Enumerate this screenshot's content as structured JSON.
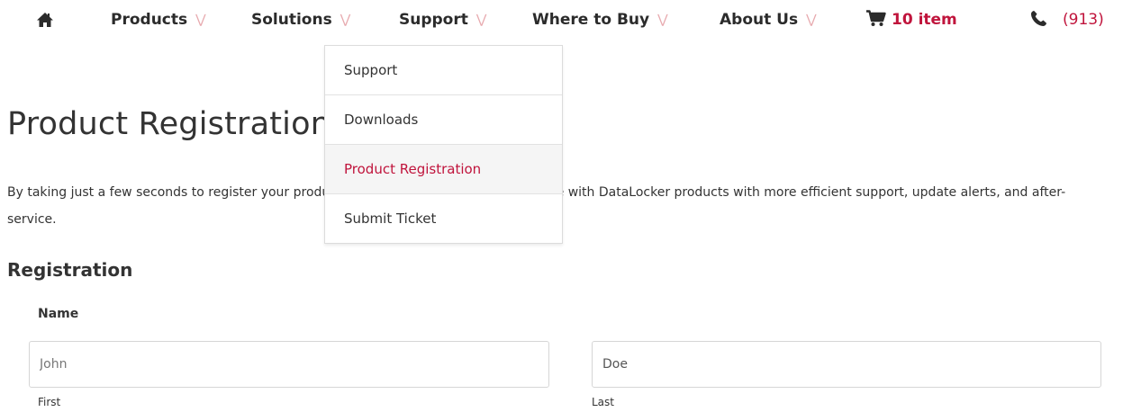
{
  "nav": {
    "home_icon": "home-icon",
    "items": [
      {
        "label": "Products"
      },
      {
        "label": "Solutions"
      },
      {
        "label": "Support"
      },
      {
        "label": "Where to Buy"
      },
      {
        "label": "About Us"
      }
    ],
    "chevron_icon": "double-chevron-down-icon",
    "cart": {
      "icon": "cart-icon",
      "count": "10 item"
    },
    "phone": {
      "icon": "phone-icon",
      "number": "(913)"
    }
  },
  "dropdown": {
    "items": [
      {
        "label": "Support",
        "active": false
      },
      {
        "label": "Downloads",
        "active": false
      },
      {
        "label": "Product Registration",
        "active": true
      },
      {
        "label": "Submit Ticket",
        "active": false
      }
    ]
  },
  "page": {
    "title": "Product Registration",
    "intro": "By taking just a few seconds to register your product, you can enhance your experience with DataLocker products with more efficient support, update alerts, and after-service."
  },
  "form": {
    "section_title": "Registration",
    "name_label": "Name",
    "first": {
      "placeholder": "John",
      "value": "",
      "sublabel": "First"
    },
    "last": {
      "placeholder": "",
      "value": "Doe",
      "sublabel": "Last"
    }
  },
  "colors": {
    "accent": "#c0143c",
    "chevron": "#e7a9ae",
    "text": "#333333",
    "border": "#d6d6d6"
  }
}
